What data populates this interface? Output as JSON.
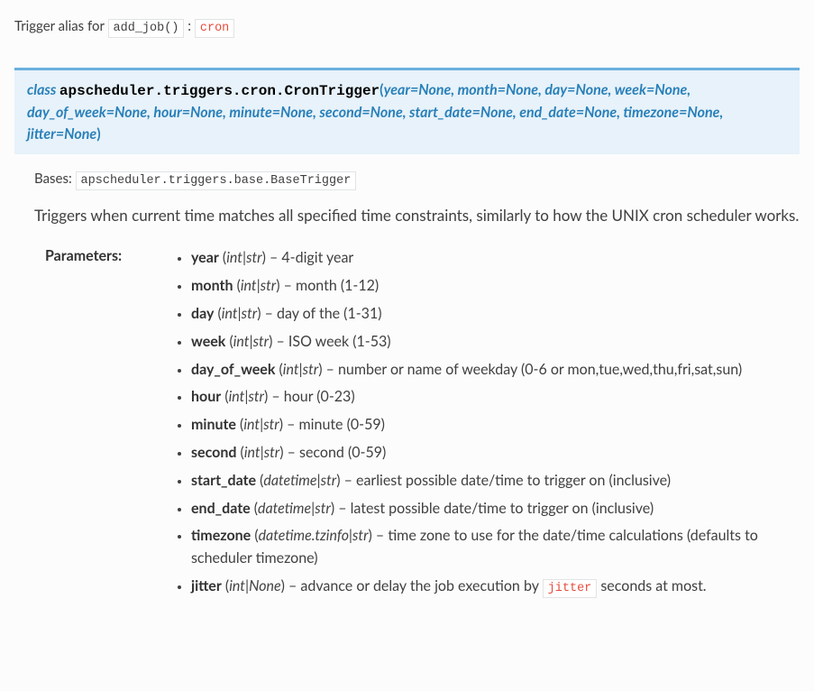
{
  "intro": {
    "prefix": "Trigger alias for ",
    "fn": "add_job()",
    "sep": ": ",
    "alias": "cron"
  },
  "signature": {
    "keyword": "class ",
    "module": "apscheduler.triggers.cron.",
    "classname": "CronTrigger",
    "args": "year=None, month=None, day=None, week=None, day_of_week=None, hour=None, minute=None, second=None, start_date=None, end_date=None, timezone=None, jitter=None"
  },
  "bases": {
    "label": "Bases: ",
    "value": "apscheduler.triggers.base.BaseTrigger"
  },
  "description": "Triggers when current time matches all specified time constraints, similarly to how the UNIX cron scheduler works.",
  "params_label": "Parameters:",
  "params": [
    {
      "name": "year",
      "type": "int|str",
      "desc": "4-digit year"
    },
    {
      "name": "month",
      "type": "int|str",
      "desc": "month (1-12)"
    },
    {
      "name": "day",
      "type": "int|str",
      "desc": "day of the (1-31)"
    },
    {
      "name": "week",
      "type": "int|str",
      "desc": "ISO week (1-53)"
    },
    {
      "name": "day_of_week",
      "type": "int|str",
      "desc": "number or name of weekday (0-6 or mon,tue,wed,thu,fri,sat,sun)"
    },
    {
      "name": "hour",
      "type": "int|str",
      "desc": "hour (0-23)"
    },
    {
      "name": "minute",
      "type": "int|str",
      "desc": "minute (0-59)"
    },
    {
      "name": "second",
      "type": "int|str",
      "desc": "second (0-59)"
    },
    {
      "name": "start_date",
      "type": "datetime|str",
      "desc": "earliest possible date/time to trigger on (inclusive)"
    },
    {
      "name": "end_date",
      "type": "datetime|str",
      "desc": "latest possible date/time to trigger on (inclusive)"
    },
    {
      "name": "timezone",
      "type": "datetime.tzinfo|str",
      "desc": "time zone to use for the date/time calculations (defaults to scheduler timezone)"
    },
    {
      "name": "jitter",
      "type": "int|None",
      "desc_before": "advance or delay the job execution by ",
      "inline_code": "jitter",
      "desc_after": " seconds at most."
    }
  ]
}
